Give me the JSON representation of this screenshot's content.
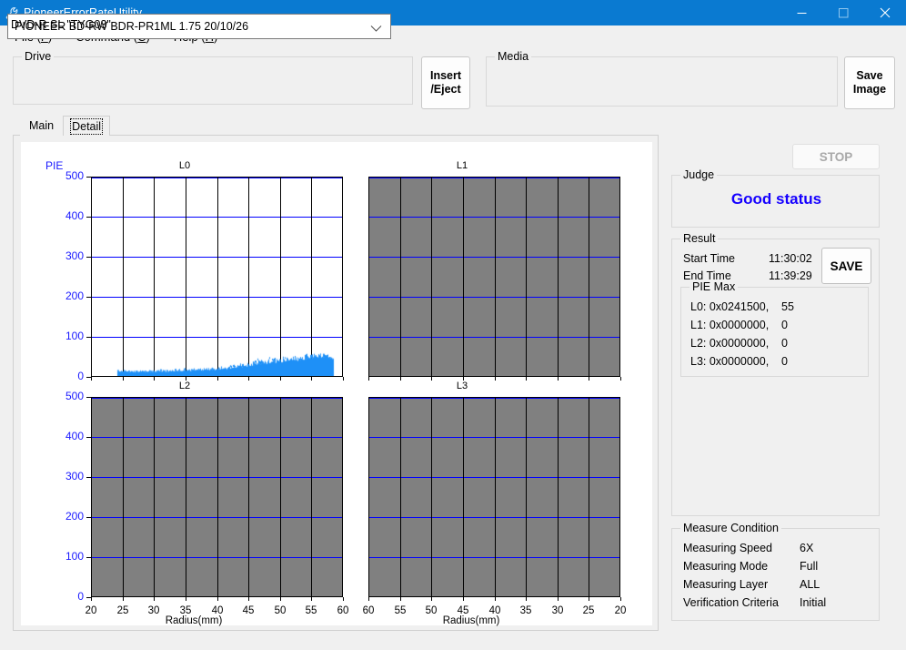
{
  "window": {
    "title": "PioneerErrorRateUtility",
    "icon": "wrench-icon",
    "titlebar_color": "#0a7ad1",
    "minimize": "—",
    "maximize": "□",
    "close": "×"
  },
  "menu": [
    {
      "label": "File",
      "accel": "F"
    },
    {
      "label": "Command",
      "accel": "C"
    },
    {
      "label": "Help",
      "accel": "H"
    }
  ],
  "drive": {
    "group_title": "Drive",
    "selected": "PIONEER BD-RW  BDR-PR1ML 1.75 20/10/26"
  },
  "insert_eject": {
    "line1": "Insert",
    "line2": "/Eject"
  },
  "media": {
    "group_title": "Media",
    "value": "DVD-R SL \"TYG03\""
  },
  "save_image": {
    "line1": "Save",
    "line2": "Image"
  },
  "tabs": [
    {
      "label": "Main",
      "active": false
    },
    {
      "label": "Detail",
      "active": true
    }
  ],
  "stop_button": {
    "label": "STOP",
    "enabled": false
  },
  "judge": {
    "group_title": "Judge",
    "value": "Good status",
    "color": "#1500ff"
  },
  "result": {
    "group_title": "Result",
    "start_time_label": "Start Time",
    "start_time_value": "11:30:02",
    "end_time_label": "End Time",
    "end_time_value": "11:39:29",
    "save_label": "SAVE",
    "pie_max": {
      "group_title": "PIE Max",
      "rows": [
        {
          "label": "L0: 0x0241500,",
          "value": "55"
        },
        {
          "label": "L1: 0x0000000,",
          "value": "0"
        },
        {
          "label": "L2: 0x0000000,",
          "value": "0"
        },
        {
          "label": "L3: 0x0000000,",
          "value": "0"
        }
      ]
    }
  },
  "measure_condition": {
    "group_title": "Measure Condition",
    "rows": [
      {
        "label": "Measuring Speed",
        "value": "6X"
      },
      {
        "label": "Measuring Mode",
        "value": "Full"
      },
      {
        "label": "Measuring Layer",
        "value": "ALL"
      },
      {
        "label": "Verification Criteria",
        "value": "Initial"
      }
    ]
  },
  "chart_data": [
    {
      "type": "area",
      "title": "L0",
      "enabled": true,
      "ylabel": "PIE",
      "xlabel": "Radius(mm)",
      "ylim": [
        0,
        500
      ],
      "yticks": [
        0,
        100,
        200,
        300,
        400,
        500
      ],
      "xlim": [
        20,
        60
      ],
      "xticks": [
        20,
        25,
        30,
        35,
        40,
        45,
        50,
        55,
        60
      ],
      "grid": true,
      "x": [
        24.0,
        25.0,
        26.0,
        27.0,
        28.0,
        29.0,
        30.0,
        31.0,
        32.0,
        33.0,
        34.0,
        35.0,
        36.0,
        37.0,
        38.0,
        39.0,
        40.0,
        41.0,
        42.0,
        43.0,
        44.0,
        45.0,
        46.0,
        47.0,
        48.0,
        49.0,
        50.0,
        51.0,
        52.0,
        53.0,
        54.0,
        55.0,
        56.0,
        57.0,
        58.0,
        58.5
      ],
      "values": [
        10,
        10,
        9,
        9,
        9,
        9,
        9,
        9,
        9,
        10,
        10,
        11,
        11,
        12,
        12,
        13,
        13,
        14,
        15,
        16,
        18,
        20,
        22,
        24,
        26,
        28,
        30,
        31,
        33,
        34,
        36,
        38,
        40,
        43,
        45,
        41
      ],
      "peak_values": [
        14,
        14,
        13,
        13,
        13,
        13,
        13,
        14,
        14,
        15,
        16,
        18,
        17,
        18,
        18,
        19,
        20,
        22,
        24,
        26,
        29,
        32,
        35,
        37,
        39,
        41,
        43,
        44,
        46,
        48,
        50,
        52,
        54,
        56,
        55,
        44
      ],
      "series_color": "#1e90f7",
      "pie_max": 55
    },
    {
      "type": "area",
      "title": "L1",
      "enabled": false,
      "ylabel": "PIE",
      "xlabel": "Radius(mm)",
      "ylim": [
        0,
        500
      ],
      "yticks": [
        0,
        100,
        200,
        300,
        400,
        500
      ],
      "xlim": [
        60,
        20
      ],
      "xticks": [
        60,
        55,
        50,
        45,
        40,
        35,
        30,
        25,
        20
      ],
      "grid": true,
      "x": [],
      "values": []
    },
    {
      "type": "area",
      "title": "L2",
      "enabled": false,
      "ylabel": "PIE",
      "xlabel": "Radius(mm)",
      "ylim": [
        0,
        500
      ],
      "yticks": [
        0,
        100,
        200,
        300,
        400,
        500
      ],
      "xlim": [
        20,
        60
      ],
      "xticks": [
        20,
        25,
        30,
        35,
        40,
        45,
        50,
        55,
        60
      ],
      "grid": true,
      "x": [],
      "values": []
    },
    {
      "type": "area",
      "title": "L3",
      "enabled": false,
      "ylabel": "PIE",
      "xlabel": "Radius(mm)",
      "ylim": [
        0,
        500
      ],
      "yticks": [
        0,
        100,
        200,
        300,
        400,
        500
      ],
      "xlim": [
        60,
        20
      ],
      "xticks": [
        60,
        55,
        50,
        45,
        40,
        35,
        30,
        25,
        20
      ],
      "grid": true,
      "x": [],
      "values": []
    }
  ],
  "axis_text": {
    "pie_label": "PIE",
    "radius_label": "Radius(mm)"
  }
}
